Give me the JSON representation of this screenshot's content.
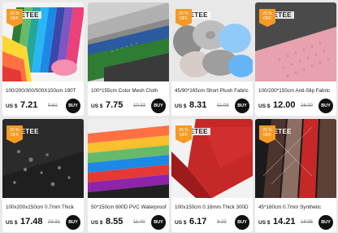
{
  "products": [
    {
      "badge_pct": "25 %",
      "badge_off": "OFF",
      "brand": "EETEE",
      "title": "100/200/300/500X150cm 190T",
      "currency": "US $",
      "price": "7.21",
      "old_price": "9.61",
      "buy": "BUY"
    },
    {
      "badge_pct": "",
      "badge_off": "",
      "brand": "",
      "title": "100*155cm Color Mesh Cloth",
      "currency": "US $",
      "price": "7.75",
      "old_price": "10.33",
      "buy": "BUY"
    },
    {
      "badge_pct": "25 %",
      "badge_off": "OFF",
      "brand": "EETEE",
      "title": "45/90*165cm Short Plush Fabric",
      "currency": "US $",
      "price": "8.31",
      "old_price": "11.08",
      "buy": "BUY"
    },
    {
      "badge_pct": "25 %",
      "badge_off": "OFF",
      "brand": "EETEE",
      "title": "100/200*150cm Anti-Slip Fabric",
      "currency": "US $",
      "price": "12.00",
      "old_price": "16.00",
      "buy": "BUY"
    },
    {
      "badge_pct": "25 %",
      "badge_off": "OFF",
      "brand": "EETEE",
      "title": "100x200x150cm 0.7mm Thick",
      "currency": "US $",
      "price": "17.48",
      "old_price": "23.31",
      "buy": "BUY"
    },
    {
      "badge_pct": "",
      "badge_off": "",
      "brand": "",
      "title": "50*150cm 600D PVC Waterproof",
      "currency": "US $",
      "price": "8.55",
      "old_price": "11.40",
      "buy": "BUY"
    },
    {
      "badge_pct": "25 %",
      "badge_off": "OFF",
      "brand": "EETEE",
      "title": "100x150cm 0.16mm Thick 300D",
      "currency": "US $",
      "price": "6.17",
      "old_price": "8.23",
      "buy": "BUY"
    },
    {
      "badge_pct": "25 %",
      "badge_off": "OFF",
      "brand": "EETEE",
      "title": "45*160cm 0.7mm Synthetic",
      "currency": "US $",
      "price": "14.21",
      "old_price": "18.95",
      "buy": "BUY"
    }
  ]
}
